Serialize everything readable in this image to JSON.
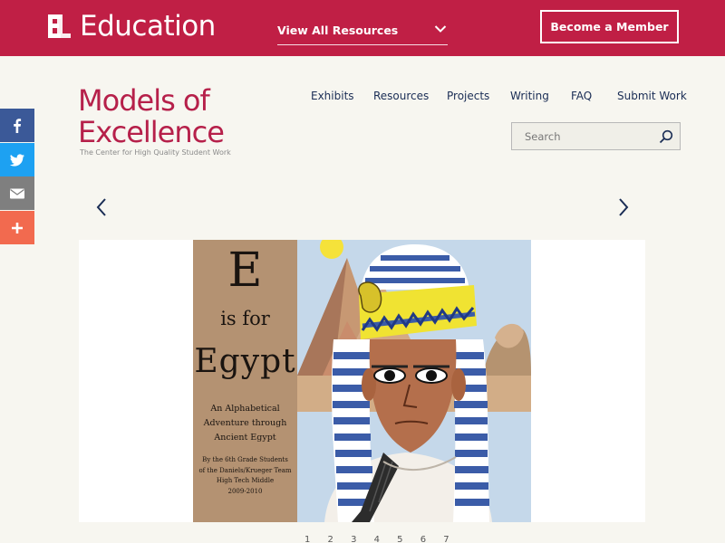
{
  "header": {
    "brand": "Education",
    "logo_icon": "el-logo-icon",
    "view_all": "View All Resources",
    "member_button": "Become a Member",
    "background": "#c01f45"
  },
  "site": {
    "title_line1": "Models of",
    "title_line2": "Excellence",
    "subtitle": "The Center for High Quality Student Work",
    "accent": "#b6204a"
  },
  "nav": {
    "items": [
      "Exhibits",
      "Resources",
      "Projects",
      "Writing",
      "FAQ",
      "Submit Work"
    ]
  },
  "search": {
    "placeholder": "Search",
    "value": ""
  },
  "share": {
    "items": [
      {
        "name": "facebook",
        "icon": "facebook-icon",
        "color": "#3b5998"
      },
      {
        "name": "twitter",
        "icon": "twitter-icon",
        "color": "#1da1f2"
      },
      {
        "name": "email",
        "icon": "email-icon",
        "color": "#7f7f7f"
      },
      {
        "name": "more",
        "icon": "plus-icon",
        "color": "#f26a4f"
      }
    ]
  },
  "slide": {
    "cover": {
      "letter": "E",
      "is_for": "is for",
      "word": "Egypt",
      "subtitle_lines": [
        "An Alphabetical",
        "Adventure through",
        "Ancient Egypt"
      ],
      "credit_lines": [
        "By the 6th Grade Students",
        "of the Daniels/Krueger Team",
        "High Tech Middle",
        "2009-2010"
      ]
    }
  },
  "pager": {
    "pages": "1 2 3 4 5 6 7"
  }
}
